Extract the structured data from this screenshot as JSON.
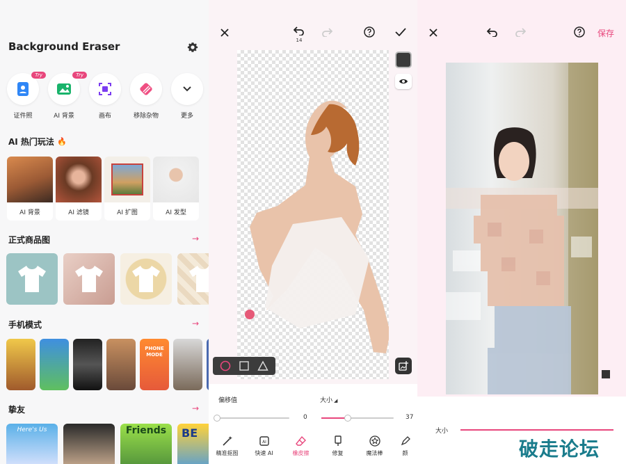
{
  "home": {
    "title": "Background Eraser",
    "tools": [
      {
        "label": "证件照",
        "badge": "Try"
      },
      {
        "label": "AI 背景",
        "badge": "Try"
      },
      {
        "label": "画布",
        "badge": ""
      },
      {
        "label": "移除杂物",
        "badge": ""
      },
      {
        "label": "更多",
        "badge": ""
      }
    ],
    "hot_section": {
      "title": "AI 热门玩法",
      "emoji": "🔥"
    },
    "hot_cards": [
      "AI 背景",
      "AI 滤镜",
      "AI 扩图",
      "AI 发型"
    ],
    "product_section": {
      "title": "正式商品图",
      "arrow": "→"
    },
    "phone_section": {
      "title": "手机模式",
      "arrow": "→"
    },
    "friends_section": {
      "title": "挚友",
      "arrow": "→"
    },
    "phone_card_text": "PHONE MODE",
    "friend_card_texts": [
      "Here's Us",
      "Friends",
      "BE"
    ]
  },
  "editor": {
    "undo_count": "14",
    "offset_label": "偏移值",
    "size_label": "大小",
    "offset_value": "0",
    "size_value": "37",
    "size_fraction": 0.37,
    "offset_fraction": 0.0,
    "tabs": [
      "精准抠图",
      "快速 AI",
      "橡皮擦",
      "修复",
      "魔法棒",
      "颜"
    ],
    "active_tab": 2
  },
  "preview": {
    "save_label": "保存",
    "size_label": "大小",
    "watermark": "破走论坛"
  },
  "colors": {
    "accent": "#e8467c",
    "active_tab": "#e8467c",
    "dark_swatch": "#3a3a3a"
  }
}
